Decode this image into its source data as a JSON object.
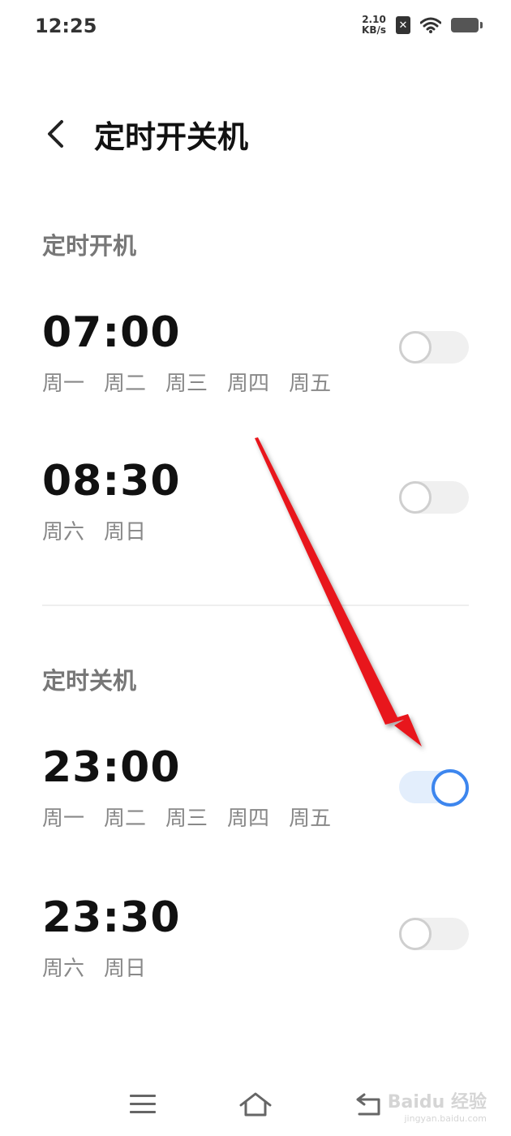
{
  "status_bar": {
    "time": "12:25",
    "net_speed_value": "2.10",
    "net_speed_unit": "KB/s",
    "sim_icon": "sim-x-icon",
    "wifi_icon": "wifi-icon",
    "battery_icon": "battery-icon"
  },
  "header": {
    "back_icon": "chevron-left-icon",
    "title": "定时开关机"
  },
  "power_on": {
    "section_title": "定时开机",
    "items": [
      {
        "time": "07:00",
        "days": [
          "周一",
          "周二",
          "周三",
          "周四",
          "周五"
        ],
        "enabled": false
      },
      {
        "time": "08:30",
        "days": [
          "周六",
          "周日"
        ],
        "enabled": false
      }
    ]
  },
  "power_off": {
    "section_title": "定时关机",
    "items": [
      {
        "time": "23:00",
        "days": [
          "周一",
          "周二",
          "周三",
          "周四",
          "周五"
        ],
        "enabled": true
      },
      {
        "time": "23:30",
        "days": [
          "周六",
          "周日"
        ],
        "enabled": false
      }
    ]
  },
  "colors": {
    "accent": "#3d86ee",
    "arrow": "#e8141b"
  },
  "nav_bar": {
    "menu_icon": "menu-icon",
    "home_icon": "home-icon",
    "back_icon": "back-return-icon"
  },
  "watermark": {
    "brand": "Baidu 经验",
    "url": "jingyan.baidu.com"
  }
}
